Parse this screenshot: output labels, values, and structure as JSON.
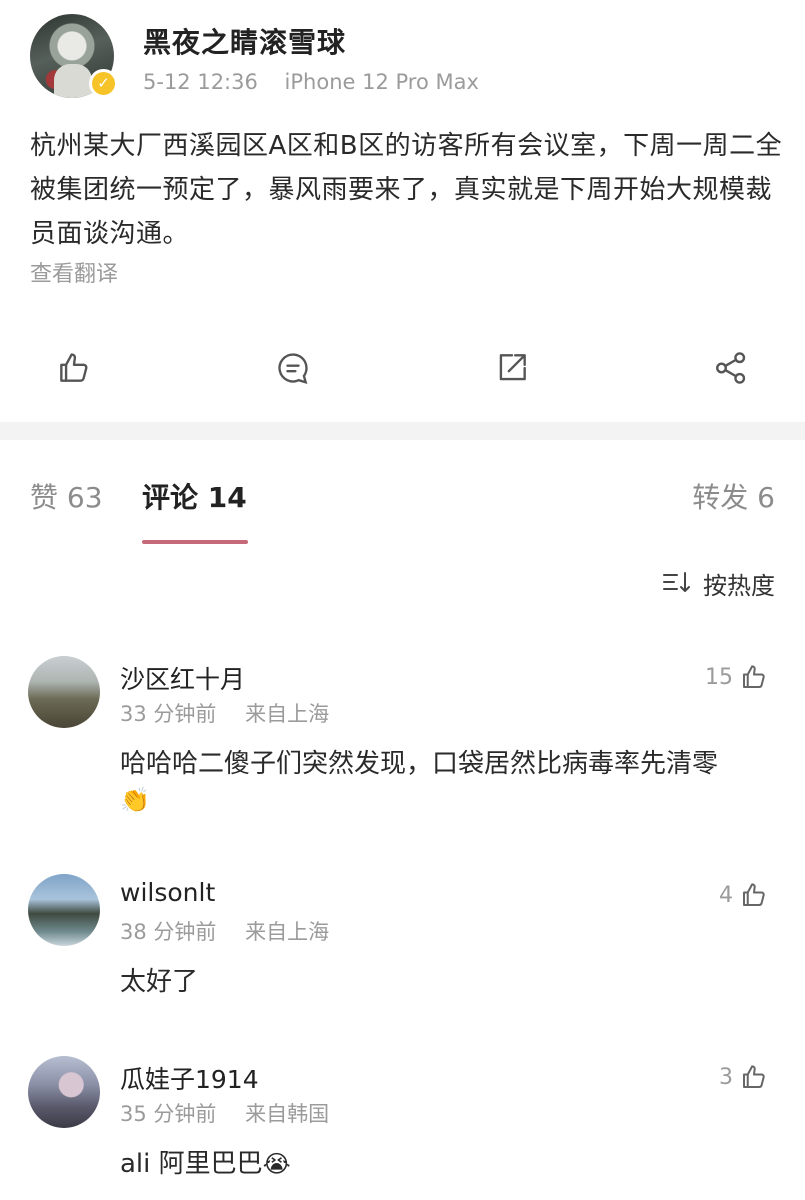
{
  "post": {
    "author": "黑夜之睛滚雪球",
    "time": "5-12 12:36",
    "device": "iPhone 12 Pro Max",
    "text": "杭州某大厂西溪园区A区和B区的访客所有会议室，下周一周二全被集团统一预定了，暴风雨要来了，真实就是下周开始大规模裁员面谈沟通。",
    "translate_label": "查看翻译",
    "verified_icon": "verified-badge-icon"
  },
  "actions": {
    "like_icon": "thumbs-up-icon",
    "comment_icon": "comment-icon",
    "repost_icon": "repost-icon",
    "share_icon": "share-icon"
  },
  "tabs": {
    "likes": "赞 63",
    "comments": "评论 14",
    "reposts": "转发 6"
  },
  "sort": {
    "label": "按热度",
    "icon": "sort-icon"
  },
  "comments": [
    {
      "name": "沙区红十月",
      "time": "33 分钟前",
      "location": "来自上海",
      "text": "哈哈哈二傻子们突然发现，口袋居然比病毒率先清零",
      "emoji": "👏",
      "likes": "15"
    },
    {
      "name": "wilsonlt",
      "time": "38 分钟前",
      "location": "来自上海",
      "text": "太好了",
      "emoji": "",
      "likes": "4"
    },
    {
      "name": "瓜娃子1914",
      "time": "35 分钟前",
      "location": "来自韩国",
      "text": "ali 阿里巴巴",
      "emoji": "😭",
      "likes": "3"
    }
  ],
  "colors": {
    "accent_tab": "#c66a7a",
    "verified": "#f6c428",
    "muted_text": "#9b9b9b"
  }
}
